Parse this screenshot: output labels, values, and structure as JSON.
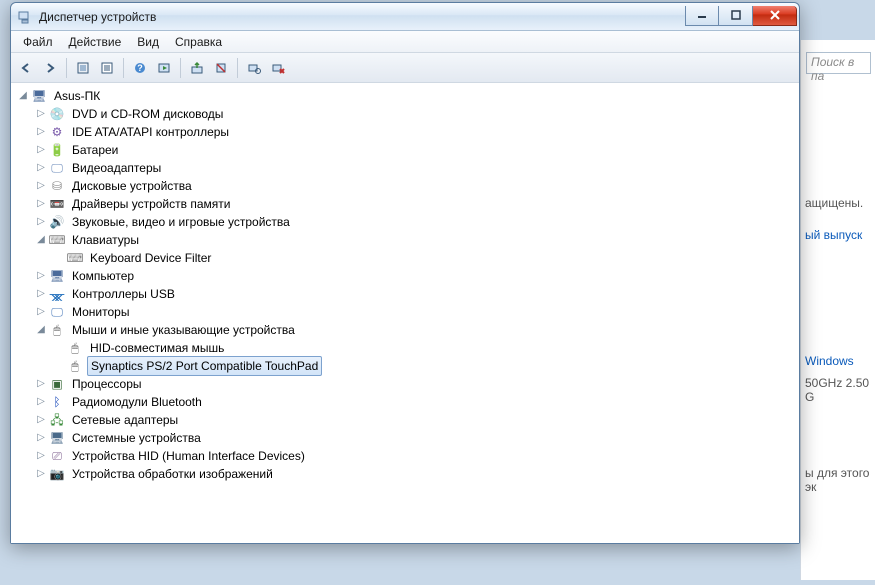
{
  "window": {
    "title": "Диспетчер устройств"
  },
  "menu": {
    "file": "Файл",
    "action": "Действие",
    "view": "Вид",
    "help": "Справка"
  },
  "toolbar": {
    "back": "←",
    "forward": "→"
  },
  "tree": {
    "root": "Asus-ПК",
    "dvd": "DVD и CD-ROM дисководы",
    "ide": "IDE ATA/ATAPI контроллеры",
    "bat": "Батареи",
    "video": "Видеоадаптеры",
    "disk": "Дисковые устройства",
    "memdrv": "Драйверы устройств памяти",
    "sound": "Звуковые, видео и игровые устройства",
    "keyboards": "Клавиатуры",
    "kbd_child": "Keyboard Device Filter",
    "computer": "Компьютер",
    "usb": "Контроллеры USB",
    "monitors": "Мониторы",
    "mice": "Мыши и иные указывающие устройства",
    "mice_hid": "HID-совместимая мышь",
    "mice_syn": "Synaptics PS/2 Port Compatible TouchPad",
    "cpu": "Процессоры",
    "bt": "Радиомодули Bluetooth",
    "net": "Сетевые адаптеры",
    "sys": "Системные устройства",
    "hid": "Устройства HID (Human Interface Devices)",
    "imaging": "Устройства обработки изображений"
  },
  "background": {
    "search_placeholder": "Поиск в па",
    "text1": "ащищены.",
    "link1": "ый выпуск",
    "link2": "Windows",
    "text2": "50GHz  2.50 G",
    "text3": "ы для этого эк"
  }
}
